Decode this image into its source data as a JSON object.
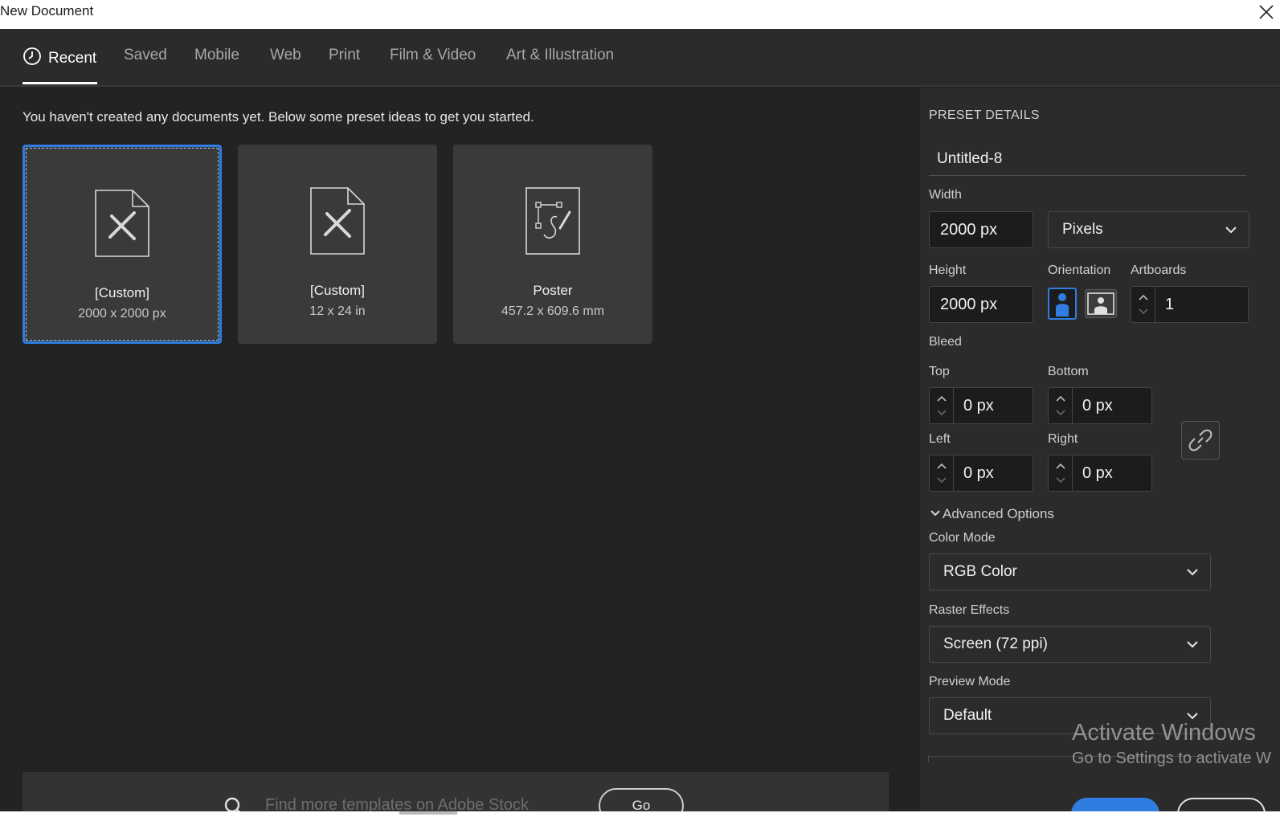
{
  "window": {
    "title": "New Document"
  },
  "tabs": [
    {
      "label": "Recent"
    },
    {
      "label": "Saved"
    },
    {
      "label": "Mobile"
    },
    {
      "label": "Web"
    },
    {
      "label": "Print"
    },
    {
      "label": "Film & Video"
    },
    {
      "label": "Art & Illustration"
    }
  ],
  "intro_text": "You haven't created any documents yet. Below some preset ideas to get you started.",
  "presets": [
    {
      "name": "[Custom]",
      "dims": "2000 x 2000 px",
      "icon": "ruler-pencil-doc-icon"
    },
    {
      "name": "[Custom]",
      "dims": "12 x 24 in",
      "icon": "ruler-pencil-doc-icon"
    },
    {
      "name": "Poster",
      "dims": "457.2 x 609.6 mm",
      "icon": "pen-path-doc-icon"
    }
  ],
  "stock": {
    "placeholder": "Find more templates on Adobe Stock",
    "go_label": "Go"
  },
  "preset_details": {
    "heading": "PRESET DETAILS",
    "doc_name": "Untitled-8",
    "width_label": "Width",
    "width_value": "2000 px",
    "units": "Pixels",
    "height_label": "Height",
    "height_value": "2000 px",
    "orientation_label": "Orientation",
    "artboards_label": "Artboards",
    "artboards_value": "1",
    "bleed_label": "Bleed",
    "top_label": "Top",
    "top_value": "0 px",
    "bottom_label": "Bottom",
    "bottom_value": "0 px",
    "left_label": "Left",
    "left_value": "0 px",
    "right_label": "Right",
    "right_value": "0 px",
    "advanced_label": "Advanced Options",
    "color_mode_label": "Color Mode",
    "color_mode_value": "RGB Color",
    "raster_label": "Raster Effects",
    "raster_value": "Screen (72 ppi)",
    "preview_label": "Preview Mode",
    "preview_value": "Default"
  },
  "watermark": {
    "line1": "Activate Windows",
    "line2": "Go to Settings to activate W"
  },
  "colors": {
    "accent": "#2f7de1",
    "background": "#232323",
    "panel": "#2b2b2b"
  }
}
